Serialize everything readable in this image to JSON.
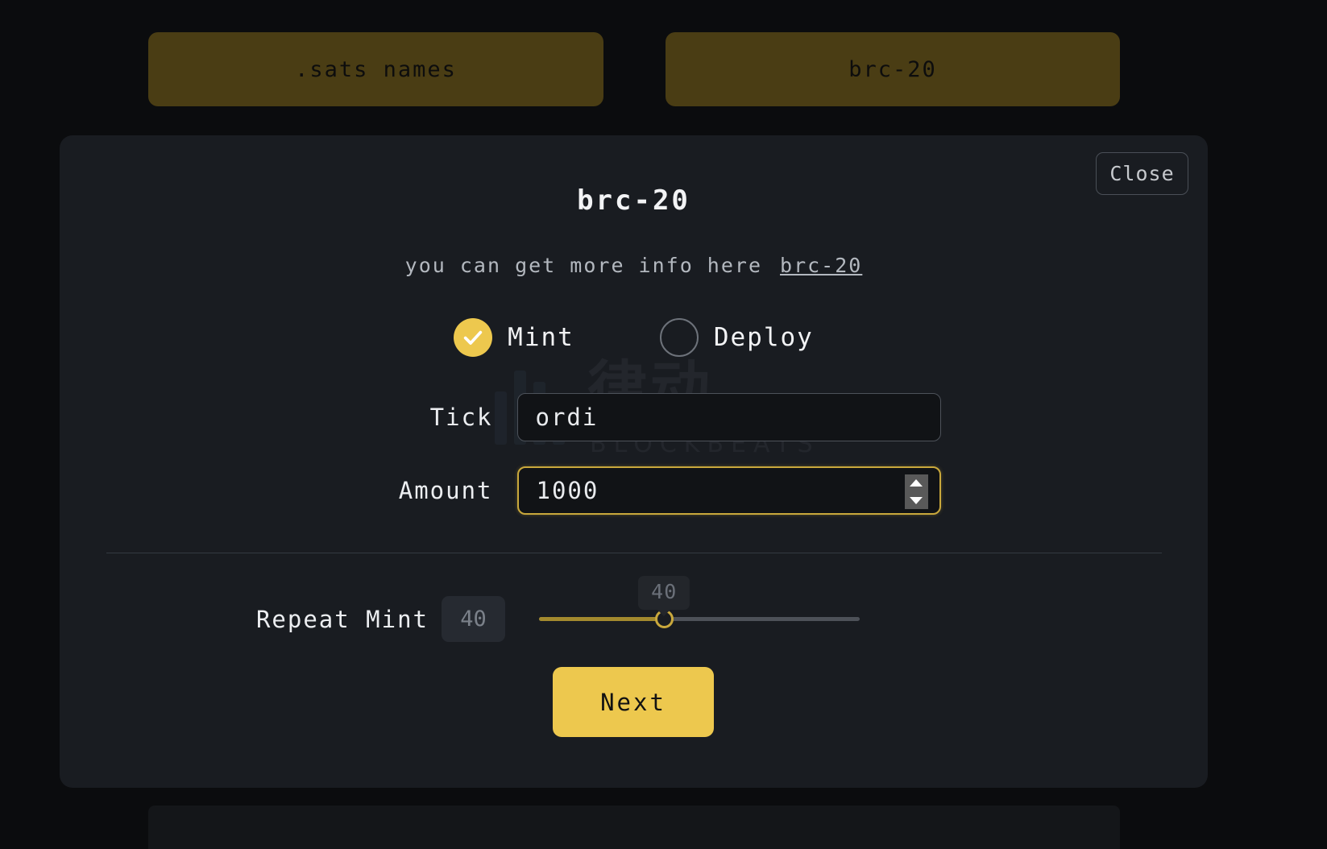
{
  "tabs": [
    {
      "id": "sats-names",
      "label": ".sats names"
    },
    {
      "id": "brc-20",
      "label": "brc-20"
    }
  ],
  "modal": {
    "title": "brc-20",
    "close_label": "Close",
    "info_text": "you can get more info here",
    "info_link_label": "brc-20",
    "options": [
      {
        "id": "mint",
        "label": "Mint",
        "selected": true
      },
      {
        "id": "deploy",
        "label": "Deploy",
        "selected": false
      }
    ],
    "fields": [
      {
        "id": "tick",
        "label": "Tick",
        "value": "ordi",
        "focused": false
      },
      {
        "id": "amount",
        "label": "Amount",
        "value": "1000",
        "focused": true
      }
    ],
    "repeat_mint": {
      "label": "Repeat Mint",
      "value": "40",
      "tooltip": "40",
      "min": "0",
      "max": "100",
      "percent": 39
    },
    "next_label": "Next"
  },
  "watermark": {
    "text": "律动",
    "subtext": "BLOCKBEATS"
  },
  "colors": {
    "accent": "#edc84e",
    "tab_bg": "#4a3d14",
    "panel_bg": "#191c21",
    "page_bg": "#0b0c0e",
    "focus_border": "#c9a83c"
  }
}
